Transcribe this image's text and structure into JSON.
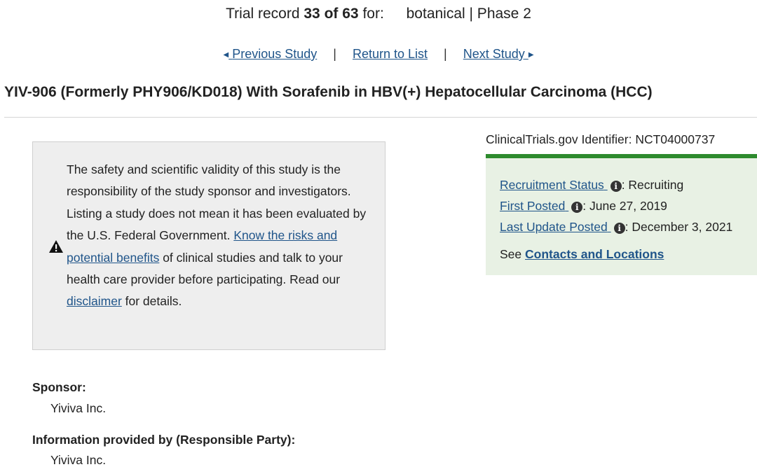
{
  "record": {
    "prefix": "Trial record",
    "current": "33 of 63",
    "for_label": "for:",
    "query": "botanical | Phase 2"
  },
  "nav": {
    "previous": "Previous Study",
    "return": "Return to List",
    "next": "Next Study",
    "separator": "|"
  },
  "study": {
    "title": "YIV-906 (Formerly PHY906/KD018) With Sorafenib in HBV(+) Hepatocellular Carcinoma (HCC)"
  },
  "disclaimer": {
    "text_1": "The safety and scientific validity of this study is the responsibility of the study sponsor and investigators. Listing a study does not mean it has been evaluated by the U.S. Federal Government. ",
    "link_risks": "Know the risks and potential benefits",
    "text_2": " of clinical studies and talk to your health care provider before participating. Read our ",
    "link_disclaimer": "disclaimer",
    "text_3": " for details."
  },
  "identifier": {
    "label": "ClinicalTrials.gov Identifier:",
    "value": "NCT04000737"
  },
  "status": {
    "recruitment_label": "Recruitment Status",
    "recruitment_value": ": Recruiting",
    "first_posted_label": "First Posted",
    "first_posted_value": ": June 27, 2019",
    "last_update_label": "Last Update Posted",
    "last_update_value": ": December 3, 2021",
    "see": "See",
    "contacts_link": "Contacts and Locations",
    "info_glyph": "i"
  },
  "sponsor": {
    "label": "Sponsor:",
    "value": "Yiviva Inc."
  },
  "responsible": {
    "label": "Information provided by (Responsible Party):",
    "value": "Yiviva Inc."
  },
  "colors": {
    "link": "#20558a",
    "status_bg": "#e8f1e4",
    "status_bar": "#2e8b2e",
    "disclaimer_bg": "#eeeeee"
  },
  "icons": {
    "nav_prev": "triangle-left-icon",
    "nav_next": "triangle-right-icon",
    "warning": "warning-icon",
    "info": "info-icon"
  }
}
